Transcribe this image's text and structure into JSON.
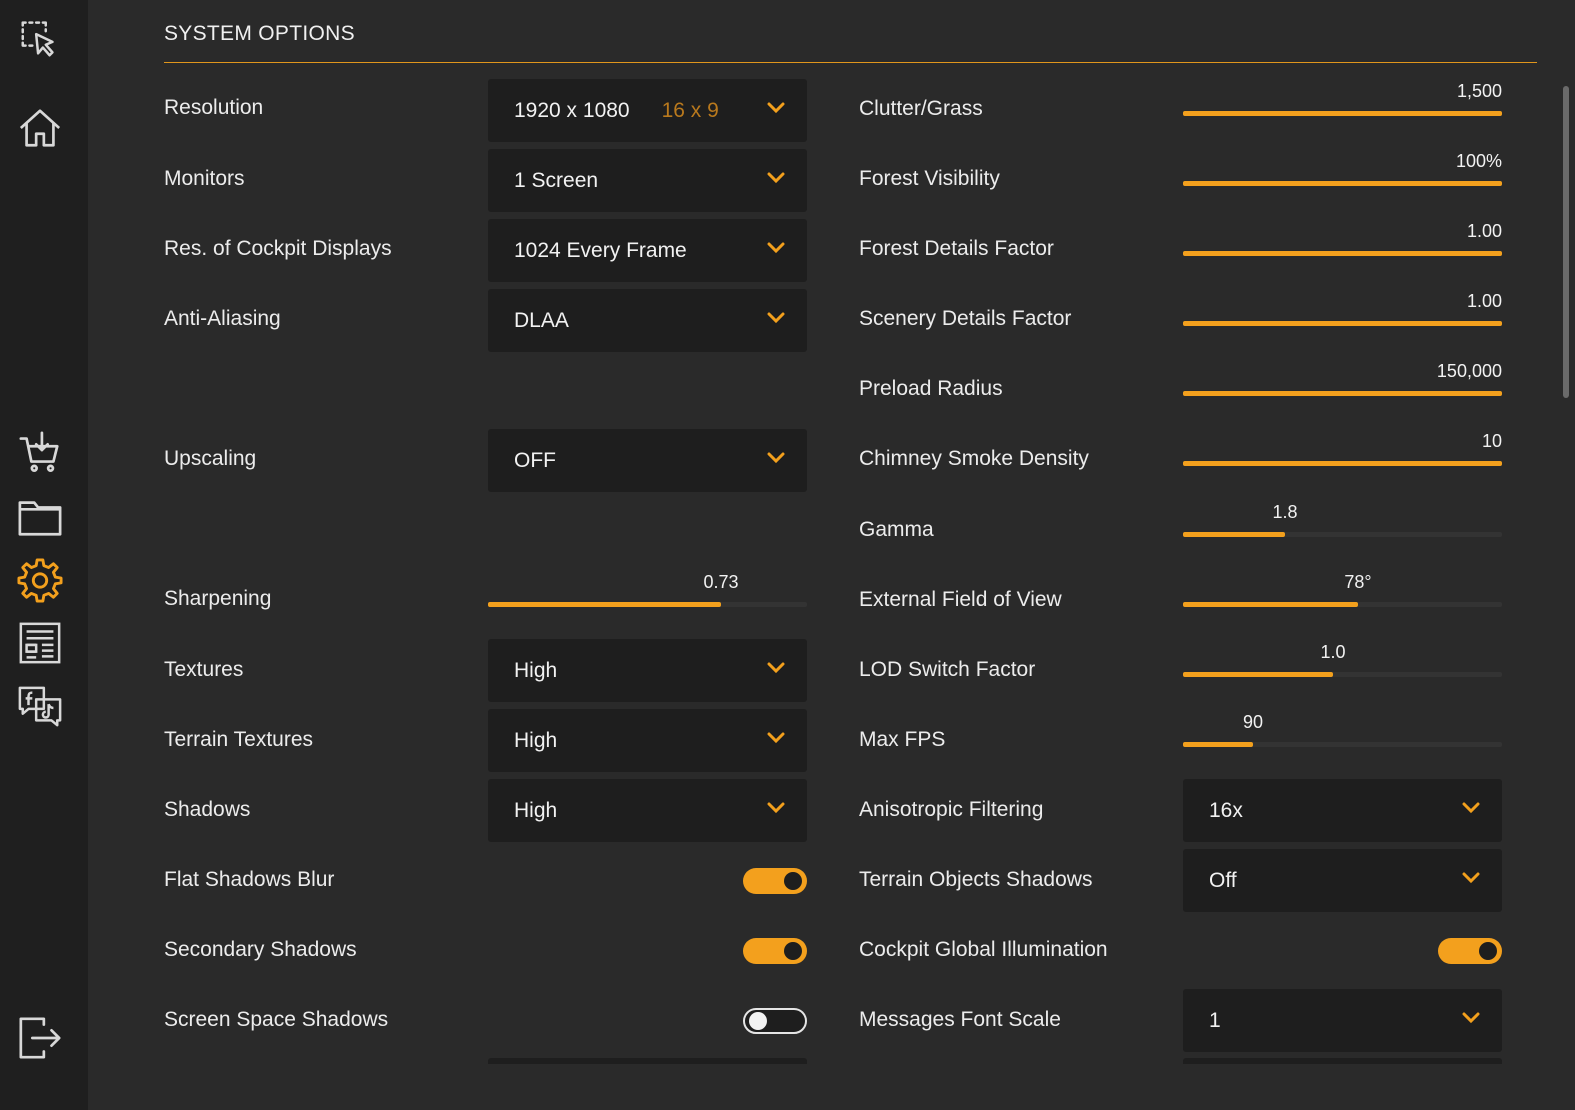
{
  "sidebar": {
    "icons": [
      "select-tool-icon",
      "home-icon",
      "cart-download-icon",
      "folder-icon",
      "gear-icon",
      "news-icon",
      "social-chat-icon",
      "logout-icon"
    ],
    "accent": "#f3a01d"
  },
  "header": {
    "title": "SYSTEM OPTIONS"
  },
  "left": {
    "resolution": {
      "label": "Resolution",
      "value": "1920 x 1080",
      "aspect": "16 x 9"
    },
    "monitors": {
      "label": "Monitors",
      "value": "1 Screen"
    },
    "cockpit_res": {
      "label": "Res. of Cockpit Displays",
      "value": "1024 Every Frame"
    },
    "anti_aliasing": {
      "label": "Anti-Aliasing",
      "value": "DLAA"
    },
    "upscaling": {
      "label": "Upscaling",
      "value": "OFF"
    },
    "sharpening": {
      "label": "Sharpening",
      "value": "0.73",
      "fraction": 0.73
    },
    "textures": {
      "label": "Textures",
      "value": "High"
    },
    "terrain_textures": {
      "label": "Terrain Textures",
      "value": "High"
    },
    "shadows": {
      "label": "Shadows",
      "value": "High"
    },
    "flat_shadows_blur": {
      "label": "Flat Shadows Blur",
      "on": true
    },
    "secondary_shadows": {
      "label": "Secondary Shadows",
      "on": true
    },
    "screen_space_shadows": {
      "label": "Screen Space Shadows",
      "on": false
    }
  },
  "right": {
    "clutter": {
      "label": "Clutter/Grass",
      "value": "1,500",
      "fraction": 1.0
    },
    "forest_visibility": {
      "label": "Forest Visibility",
      "value": "100%",
      "fraction": 1.0
    },
    "forest_details": {
      "label": "Forest Details Factor",
      "value": "1.00",
      "fraction": 1.0
    },
    "scenery_details": {
      "label": "Scenery Details Factor",
      "value": "1.00",
      "fraction": 1.0
    },
    "preload_radius": {
      "label": "Preload Radius",
      "value": "150,000",
      "fraction": 1.0
    },
    "chimney_smoke": {
      "label": "Chimney Smoke Density",
      "value": "10",
      "fraction": 1.0
    },
    "gamma": {
      "label": "Gamma",
      "value": "1.8",
      "fraction": 0.32
    },
    "external_fov": {
      "label": "External Field of View",
      "value": "78°",
      "fraction": 0.55
    },
    "lod_switch": {
      "label": "LOD Switch Factor",
      "value": "1.0",
      "fraction": 0.47
    },
    "max_fps": {
      "label": "Max FPS",
      "value": "90",
      "fraction": 0.22
    },
    "anisotropic": {
      "label": "Anisotropic Filtering",
      "value": "16x"
    },
    "terrain_objects_shadows": {
      "label": "Terrain Objects Shadows",
      "value": "Off"
    },
    "cockpit_gi": {
      "label": "Cockpit Global Illumination",
      "on": true
    },
    "messages_font_scale": {
      "label": "Messages Font Scale",
      "value": "1"
    }
  }
}
